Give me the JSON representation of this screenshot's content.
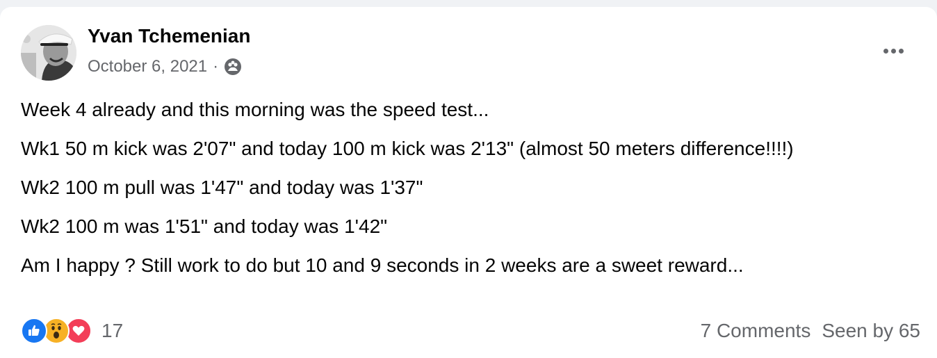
{
  "post": {
    "author": "Yvan Tchemenian",
    "date": "October 6, 2021",
    "separator": "·",
    "audience_icon": "group-audience-icon",
    "more_icon": "more-options-icon",
    "lines": [
      "Week 4 already and this morning was the speed test...",
      "Wk1 50 m kick was 2'07\" and today 100 m kick was 2'13\" (almost 50 meters difference!!!!)",
      "Wk2 100 m pull was 1'47\" and today was 1'37\"",
      "Wk2 100 m was 1'51\" and today was 1'42\"",
      "Am I happy ? Still work to do but 10 and 9 seconds in 2 weeks are a sweet reward..."
    ]
  },
  "footer": {
    "reactions": [
      "like-reaction-icon",
      "wow-reaction-icon",
      "love-reaction-icon"
    ],
    "reaction_count": "17",
    "comments": "7 Comments",
    "seen_by": "Seen by 65"
  },
  "colors": {
    "like": "#1877f2",
    "wow": "#f7b125",
    "love": "#f33e58",
    "secondary_text": "#65676b",
    "primary_text": "#050505"
  }
}
